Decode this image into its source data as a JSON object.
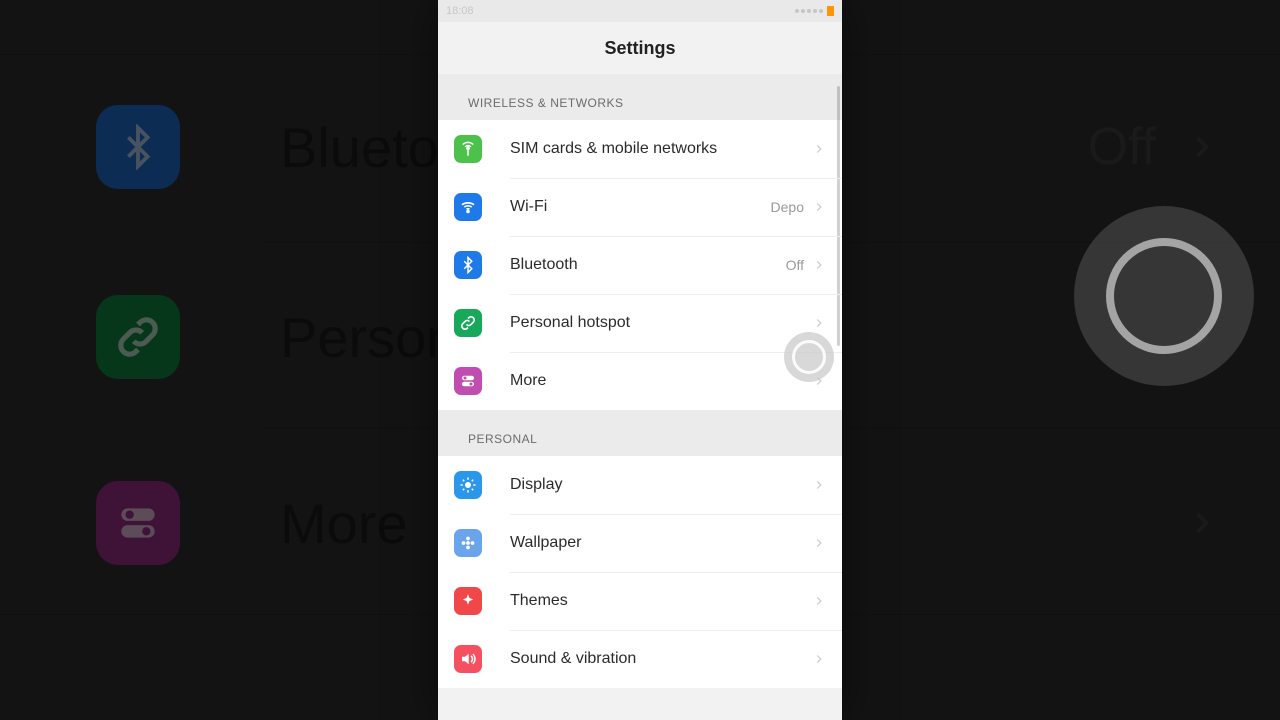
{
  "statusbar": {
    "time": "18:08"
  },
  "header": {
    "title": "Settings"
  },
  "sections": [
    {
      "title": "WIRELESS & NETWORKS",
      "items": [
        {
          "id": "sim",
          "label": "SIM cards & mobile networks",
          "value": "",
          "icon": "antenna",
          "color": "ic-green"
        },
        {
          "id": "wifi",
          "label": "Wi-Fi",
          "value": "Depo",
          "icon": "wifi",
          "color": "ic-blue"
        },
        {
          "id": "bluetooth",
          "label": "Bluetooth",
          "value": "Off",
          "icon": "bluetooth",
          "color": "ic-blue"
        },
        {
          "id": "hotspot",
          "label": "Personal hotspot",
          "value": "",
          "icon": "link",
          "color": "ic-hot"
        },
        {
          "id": "more",
          "label": "More",
          "value": "",
          "icon": "toggles",
          "color": "ic-purple"
        }
      ]
    },
    {
      "title": "PERSONAL",
      "items": [
        {
          "id": "display",
          "label": "Display",
          "value": "",
          "icon": "sun",
          "color": "ic-sky"
        },
        {
          "id": "wallpaper",
          "label": "Wallpaper",
          "value": "",
          "icon": "flower",
          "color": "ic-lav"
        },
        {
          "id": "themes",
          "label": "Themes",
          "value": "",
          "icon": "sparkle",
          "color": "ic-red"
        },
        {
          "id": "sound",
          "label": "Sound & vibration",
          "value": "",
          "icon": "speaker",
          "color": "ic-pink"
        }
      ]
    }
  ],
  "bg": {
    "bluetooth": {
      "label": "Bluetooth",
      "value": "Off"
    },
    "hotspot": {
      "label": "Personal hotspot",
      "value": ""
    },
    "more": {
      "label": "More",
      "value": ""
    }
  }
}
